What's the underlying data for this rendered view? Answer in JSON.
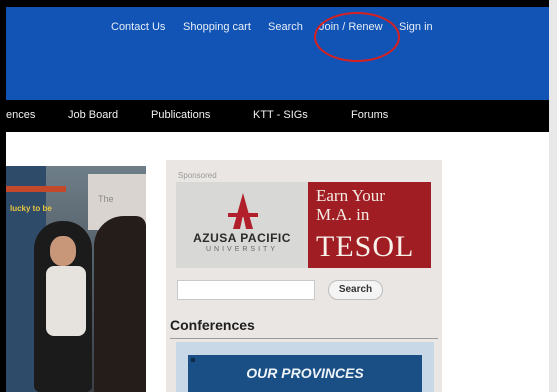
{
  "header": {
    "links": [
      {
        "label": "Contact Us"
      },
      {
        "label": "Shopping cart"
      },
      {
        "label": "Search"
      },
      {
        "label": "Join / Renew"
      },
      {
        "label": "Sign in"
      }
    ],
    "annotation_color": "#d82020",
    "bar_color": "#1154b5"
  },
  "nav": {
    "items": [
      {
        "label": "ences"
      },
      {
        "label": "Job Board"
      },
      {
        "label": "Publications"
      },
      {
        "label": "KTT - SIGs"
      },
      {
        "label": "Forums"
      }
    ]
  },
  "photo": {
    "sign_text": "lucky to be",
    "poster_text": "The"
  },
  "sidebar": {
    "sponsored_label": "Sponsored",
    "ad": {
      "university_name": "AZUSA PACIFIC",
      "university_sub": "UNIVERSITY",
      "headline_line1": "Earn Your",
      "headline_line2": "M.A. in",
      "headline_line3": "TESOL",
      "accent_color": "#a11d24"
    },
    "search": {
      "value": "",
      "button_label": "Search"
    },
    "conferences_title": "Conferences",
    "banner_text": "OUR PROVINCES"
  }
}
